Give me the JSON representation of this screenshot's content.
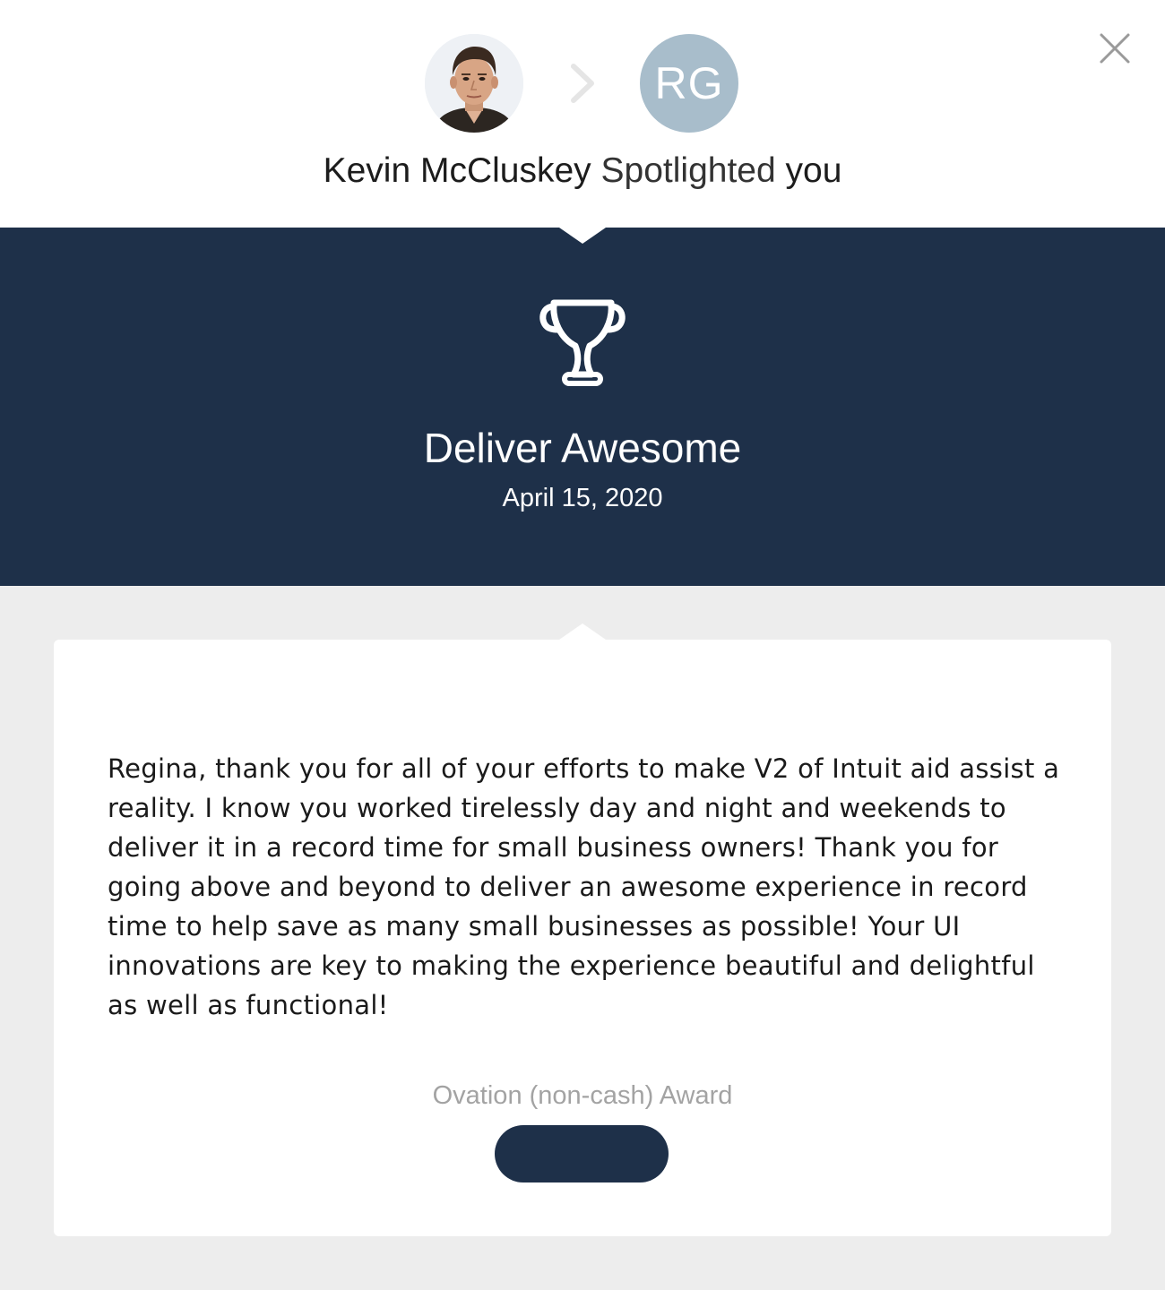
{
  "header": {
    "sender": {
      "name": "Kevin McCluskey",
      "avatar_type": "photo"
    },
    "recipient": {
      "initials": "RG",
      "avatar_color": "#a8bdcb"
    },
    "action_text": "Spotlighted",
    "target_text": "you",
    "close_icon": "close-icon",
    "chevron_icon": "chevron-right-icon"
  },
  "banner": {
    "background_color": "#1e3049",
    "icon": "trophy-icon",
    "title": "Deliver Awesome",
    "date": "April 15, 2020"
  },
  "card": {
    "message": "Regina, thank you for all of your efforts to make V2 of Intuit aid assist a reality. I know you worked tirelessly day and night and weekends to deliver it in a record time for small business owners! Thank you for going above and beyond to deliver an awesome experience in record time to help save as many small businesses as possible! Your UI innovations are key to making the experience beautiful and delightful as well as functional!",
    "award_type": "Ovation (non-cash) Award",
    "action_button_label": ""
  }
}
